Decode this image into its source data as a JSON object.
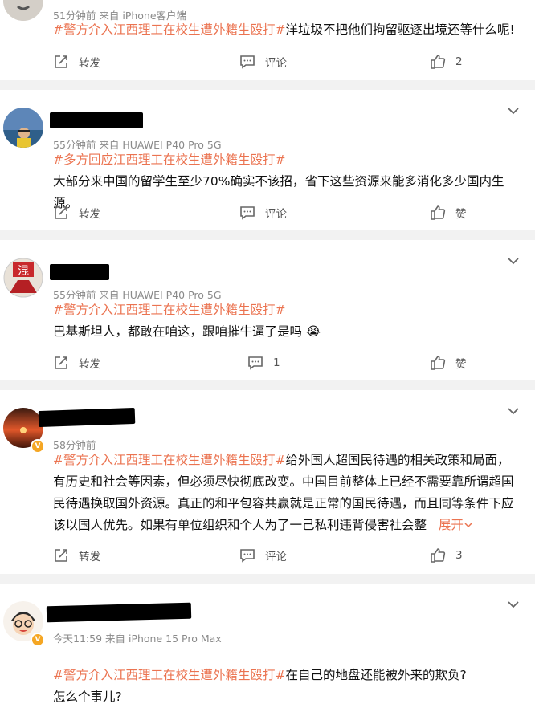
{
  "posts": [
    {
      "meta": "51分钟前   来自 iPhone客户端",
      "topic": "#警方介入江西理工在校生遭外籍生殴打#",
      "body": "洋垃圾不把他们拘留驱逐出境还等什么呢!",
      "more": "",
      "repost_label": "转发",
      "comment_label": "评论",
      "comment_count": "",
      "like_label": "2"
    },
    {
      "meta": "55分钟前   来自 HUAWEI P40 Pro 5G",
      "topic": "#多方回应江西理工在校生遭外籍生殴打#",
      "body": "大部分来中国的留学生至少70%确实不该招，省下这些资源来能多消化多少国内生源。",
      "more": "",
      "repost_label": "转发",
      "comment_label": "评论",
      "comment_count": "",
      "like_label": "赞"
    },
    {
      "meta": "55分钟前   来自 HUAWEI P40 Pro 5G",
      "topic": "#警方介入江西理工在校生遭外籍生殴打#",
      "body": "巴基斯坦人，都敢在咱这，跟咱摧牛逼了是吗 😭",
      "more": "",
      "repost_label": "转发",
      "comment_label": "",
      "comment_count": "1",
      "like_label": "赞"
    },
    {
      "meta": "58分钟前",
      "topic": "#警方介入江西理工在校生遭外籍生殴打#",
      "body": "给外国人超国民待遇的相关政策和局面，有历史和社会等因素，但必须尽快彻底改变。中国目前整体上已经不需要靠所谓超国民待遇换取国外资源。真正的和平包容共赢就是正常的国民待遇，而且同等条件下应该以国人优先。如果有单位组织和个人为了一己私利违背侵害社会整",
      "more": "展开",
      "repost_label": "转发",
      "comment_label": "评论",
      "comment_count": "",
      "like_label": "3"
    },
    {
      "meta": "今天11:59   来自 iPhone 15 Pro Max",
      "topic": "#警方介入江西理工在校生遭外籍生殴打#",
      "body": "在自己的地盘还能被外来的欺负?\n怎么个事儿?",
      "more": "",
      "repost_label": "",
      "comment_label": "",
      "comment_count": "",
      "like_label": ""
    }
  ],
  "avatar3_glyph": "混",
  "verified_glyph": "V",
  "colors": {
    "topic": "#eb7350",
    "meta": "#8a8a8a",
    "divider": "#f2f2f2"
  }
}
